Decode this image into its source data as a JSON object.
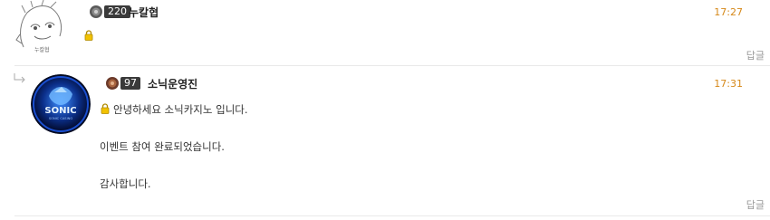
{
  "comments": [
    {
      "level": "220",
      "nickname": "누칼협",
      "time": "17:27",
      "body": "",
      "reply_label": "답글",
      "avatar_text": "누칼협"
    },
    {
      "level": "97",
      "nickname": "소닉운영진",
      "time": "17:31",
      "body_lines": [
        "안녕하세요 소닉카지노 입니다.",
        "이벤트 참여 완료되었습니다.",
        "감사합니다."
      ],
      "reply_label": "답글",
      "avatar_text": "SONIC",
      "avatar_subtext": "SONIC CASINO"
    }
  ],
  "colors": {
    "time": "#d6891a",
    "lock": "#e8b400",
    "level_badge": "#3a3a3a"
  }
}
